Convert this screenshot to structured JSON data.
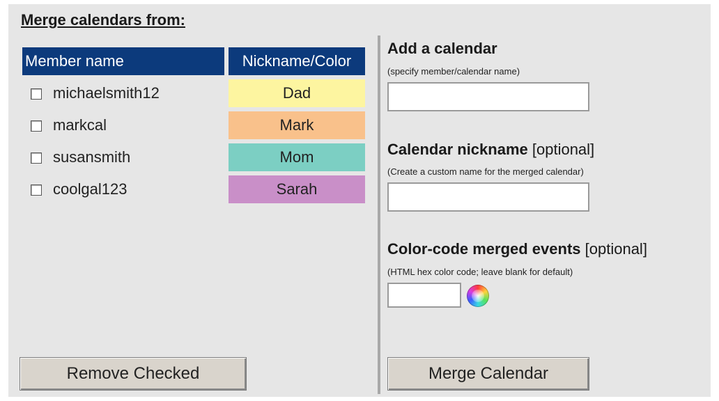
{
  "heading": "Merge calendars from:",
  "table": {
    "col_member": "Member name",
    "col_nick": "Nickname/Color",
    "rows": [
      {
        "member": "michaelsmith12",
        "nickname": "Dad",
        "color": "#fdf5a0"
      },
      {
        "member": "markcal",
        "nickname": "Mark",
        "color": "#f9c18b"
      },
      {
        "member": "susansmith",
        "nickname": "Mom",
        "color": "#7ccfc3"
      },
      {
        "member": "coolgal123",
        "nickname": "Sarah",
        "color": "#c98fc8"
      }
    ]
  },
  "add_calendar": {
    "label": "Add a calendar",
    "hint": "(specify member/calendar name)",
    "value": ""
  },
  "nickname_field": {
    "label": "Calendar nickname",
    "optional": "[optional]",
    "hint": "(Create a custom name for the merged calendar)",
    "value": ""
  },
  "color_code": {
    "label": "Color-code merged events",
    "optional": "[optional]",
    "hint": "(HTML hex color code; leave blank for default)",
    "value": "",
    "icon": "color-wheel-icon"
  },
  "buttons": {
    "remove": "Remove Checked",
    "merge": "Merge Calendar"
  },
  "colors": {
    "header_bg": "#0c3a7c",
    "panel_bg": "#e6e6e6",
    "button_bg": "#d9d4cc"
  }
}
